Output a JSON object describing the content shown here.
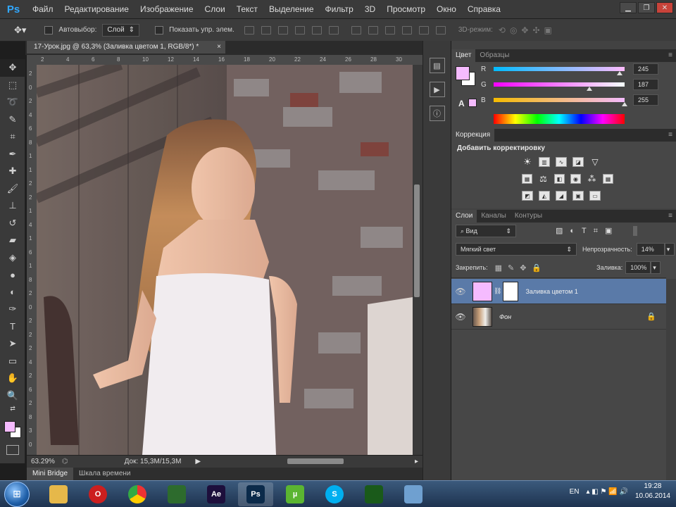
{
  "app": {
    "logo": "Ps"
  },
  "menu": [
    "Файл",
    "Редактирование",
    "Изображение",
    "Слои",
    "Текст",
    "Выделение",
    "Фильтр",
    "3D",
    "Просмотр",
    "Окно",
    "Справка"
  ],
  "window_controls": [
    "minimize-icon",
    "restore-icon",
    "close-icon"
  ],
  "options": {
    "autoselect_label": "Автовыбор:",
    "autoselect_value": "Слой",
    "show_transform_label": "Показать упр. элем.",
    "mode_3d_label": "3D-режим:"
  },
  "document": {
    "tab_title": "17-Урок.jpg @ 63,3% (Заливка цветом 1, RGB/8*) *",
    "close": "×",
    "zoom": "63.29%",
    "doc_info": "Док: 15,3M/15,3M"
  },
  "bottom_tabs": [
    "Mini Bridge",
    "Шкала времени"
  ],
  "ruler_left_ticks": [
    "2",
    "0",
    "2",
    "4",
    "6",
    "8",
    "1",
    "1",
    "2",
    "2",
    "1",
    "4",
    "1",
    "6",
    "1",
    "8",
    "2",
    "0",
    "2",
    "2",
    "2",
    "4",
    "2",
    "6",
    "2",
    "8",
    "3",
    "0"
  ],
  "ruler_top_ticks": [
    "2",
    "4",
    "6",
    "8",
    "10",
    "12",
    "14",
    "16",
    "18",
    "20",
    "22",
    "24",
    "26",
    "28",
    "30"
  ],
  "color_panel": {
    "tabs": [
      "Цвет",
      "Образцы"
    ],
    "sliders": [
      {
        "label": "R",
        "value": "245",
        "position": 0.96,
        "color": "#ff3b3b"
      },
      {
        "label": "G",
        "value": "187",
        "position": 0.73,
        "color": "#d000d0"
      },
      {
        "label": "B",
        "value": "255",
        "position": 1.0,
        "color": "#f0c000"
      }
    ],
    "foreground": "#f5bbff",
    "background": "#ffffff"
  },
  "adjustments_panel": {
    "tab": "Коррекция",
    "title": "Добавить корректировку"
  },
  "layers_panel": {
    "tabs": [
      "Слои",
      "Каналы",
      "Контуры"
    ],
    "filter_value": "Вид",
    "blend_mode": "Мягкий свет",
    "opacity_label": "Непрозрачность:",
    "opacity_value": "14%",
    "lock_label": "Закрепить:",
    "fill_label": "Заливка:",
    "fill_value": "100%",
    "layers": [
      {
        "name": "Заливка цветом 1",
        "selected": true,
        "thumb": "#f5bbff"
      },
      {
        "name": "Фон",
        "selected": false,
        "thumb": "#6b5a4f"
      }
    ]
  },
  "taskbar": {
    "apps": [
      {
        "name": "explorer",
        "label": "",
        "color": "#e6b84a"
      },
      {
        "name": "opera",
        "label": "O",
        "color": "#cc1f1f"
      },
      {
        "name": "chrome",
        "label": "",
        "color": "#3aa344"
      },
      {
        "name": "camtasia",
        "label": "",
        "color": "#2d6b2d"
      },
      {
        "name": "after-effects",
        "label": "Ae",
        "color": "#1d0f3c"
      },
      {
        "name": "photoshop",
        "label": "Ps",
        "color": "#0b2a4a"
      },
      {
        "name": "utorrent",
        "label": "µ",
        "color": "#5bb531"
      },
      {
        "name": "skype",
        "label": "S",
        "color": "#00aff0"
      },
      {
        "name": "camtasia-recorder",
        "label": "",
        "color": "#1a5a1a"
      },
      {
        "name": "screen-tool",
        "label": "",
        "color": "#6fa0d0"
      }
    ],
    "lang": "EN",
    "time": "19:28",
    "date": "10.06.2014"
  }
}
